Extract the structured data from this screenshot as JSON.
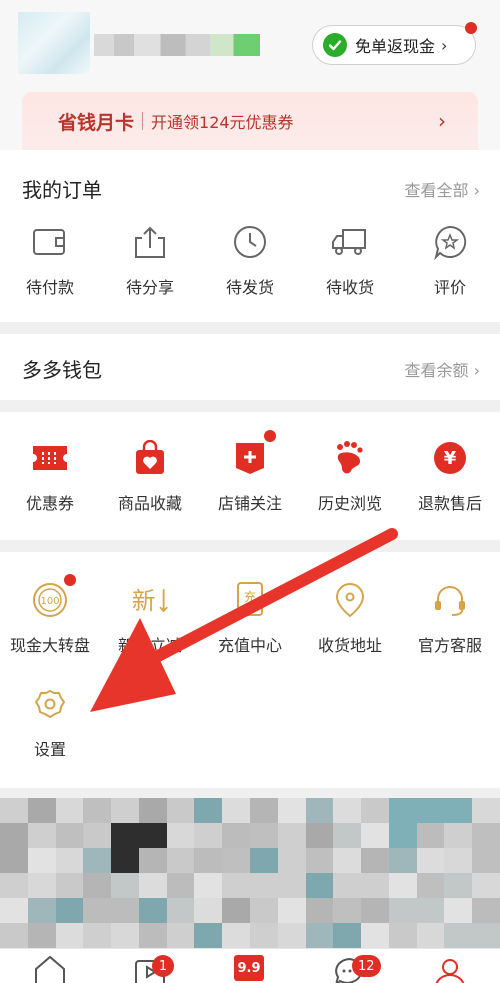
{
  "header": {
    "cashback_label": "免单返现金"
  },
  "monthly_card": {
    "title": "省钱月卡",
    "subtitle": "开通领124元优惠券"
  },
  "orders": {
    "title": "我的订单",
    "link": "查看全部",
    "items": [
      {
        "label": "待付款",
        "icon": "wallet-icon"
      },
      {
        "label": "待分享",
        "icon": "share-icon"
      },
      {
        "label": "待发货",
        "icon": "clock-icon"
      },
      {
        "label": "待收货",
        "icon": "truck-icon"
      },
      {
        "label": "评价",
        "icon": "review-icon"
      }
    ]
  },
  "wallet": {
    "title": "多多钱包",
    "link": "查看余额"
  },
  "services1": {
    "items": [
      {
        "label": "优惠券",
        "icon": "coupon-icon"
      },
      {
        "label": "商品收藏",
        "icon": "favorite-bag-icon"
      },
      {
        "label": "店铺关注",
        "icon": "store-follow-icon"
      },
      {
        "label": "历史浏览",
        "icon": "footprint-icon"
      },
      {
        "label": "退款售后",
        "icon": "refund-icon"
      }
    ]
  },
  "services2": {
    "items": [
      {
        "label": "现金大转盘",
        "icon": "wheel-icon",
        "icon_text": "100"
      },
      {
        "label": "新客立减",
        "icon": "new-customer-icon",
        "icon_text": "新"
      },
      {
        "label": "充值中心",
        "icon": "recharge-icon",
        "icon_text": "充"
      },
      {
        "label": "收货地址",
        "icon": "location-icon"
      },
      {
        "label": "官方客服",
        "icon": "headset-icon"
      }
    ],
    "settings_label": "设置"
  },
  "tabbar": {
    "badges": {
      "video": "1",
      "chat": "12"
    },
    "center_label": "9.9"
  },
  "colors": {
    "brand_red": "#e02e24",
    "gold": "#d4a449",
    "annotation_arrow": "#e8352b"
  }
}
